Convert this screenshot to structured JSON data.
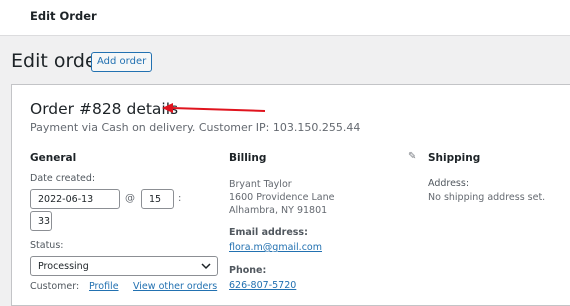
{
  "topbar": {
    "title": "Edit Order"
  },
  "page": {
    "title": "Edit order",
    "add_button": "Add order"
  },
  "order": {
    "heading": "Order #828 details",
    "subtitle": "Payment via Cash on delivery. Customer IP: 103.150.255.44"
  },
  "general": {
    "title": "General",
    "date_label": "Date created:",
    "date_value": "2022-06-13",
    "at_symbol": "@",
    "hour_value": "15",
    "colon": ":",
    "minute_value": "33",
    "status_label": "Status:",
    "status_value": "Processing",
    "customer_label": "Customer:",
    "profile_link": "Profile",
    "view_orders_link": "View other orders"
  },
  "billing": {
    "title": "Billing",
    "address_line1": "Bryant Taylor",
    "address_line2": "1600 Providence Lane",
    "address_line3": "Alhambra, NY 91801",
    "email_label": "Email address:",
    "email_value": "flora.m@gmail.com",
    "phone_label": "Phone:",
    "phone_value": "626-807-5720"
  },
  "shipping": {
    "title": "Shipping",
    "address_label": "Address:",
    "address_value": "No shipping address set."
  },
  "colors": {
    "accent": "#2271b1",
    "arrow": "#e0141e"
  }
}
